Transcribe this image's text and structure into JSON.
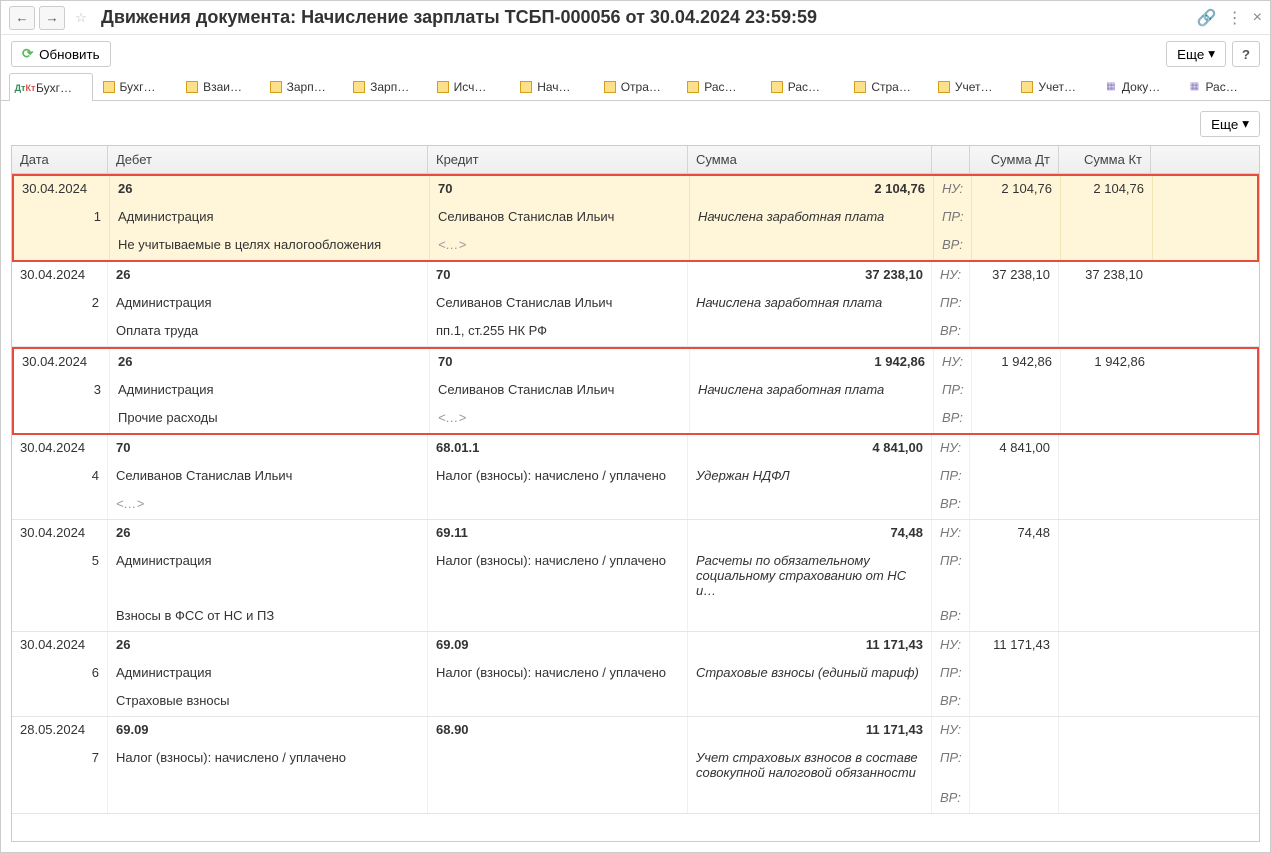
{
  "titlebar": {
    "title": "Движения документа: Начисление зарплаты ТСБП-000056 от 30.04.2024 23:59:59"
  },
  "toolbar": {
    "refresh_label": "Обновить",
    "more_label": "Еще",
    "help_label": "?"
  },
  "tabs": [
    {
      "label": "Бухг…",
      "active": true,
      "icon": "dtkt"
    },
    {
      "label": "Бухг…",
      "icon": "reg"
    },
    {
      "label": "Взаи…",
      "icon": "reg"
    },
    {
      "label": "Зарп…",
      "icon": "reg"
    },
    {
      "label": "Зарп…",
      "icon": "reg"
    },
    {
      "label": "Исч…",
      "icon": "reg"
    },
    {
      "label": "Нач…",
      "icon": "reg"
    },
    {
      "label": "Отра…",
      "icon": "reg"
    },
    {
      "label": "Рас…",
      "icon": "reg"
    },
    {
      "label": "Рас…",
      "icon": "reg"
    },
    {
      "label": "Стра…",
      "icon": "reg"
    },
    {
      "label": "Учет…",
      "icon": "reg"
    },
    {
      "label": "Учет…",
      "icon": "reg"
    },
    {
      "label": "Доку…",
      "icon": "tbl"
    },
    {
      "label": "Рас…",
      "icon": "tbl"
    }
  ],
  "inner_more_label": "Еще",
  "grid": {
    "headers": {
      "date": "Дата",
      "debit": "Дебет",
      "credit": "Кредит",
      "sum": "Сумма",
      "flag": "",
      "sumdt": "Сумма Дт",
      "sumkt": "Сумма Кт"
    },
    "flags": {
      "nu": "НУ:",
      "pr": "ПР:",
      "vr": "ВР:"
    },
    "entries": [
      {
        "highlight": true,
        "num": "1",
        "date": "30.04.2024",
        "debit_acct": "26",
        "credit_acct": "70",
        "sum": "2 104,76",
        "sumdt": "2 104,76",
        "sumkt": "2 104,76",
        "debit_l2": "Администрация",
        "credit_l2": "Селиванов Станислав Ильич",
        "desc_l2": "Начислена заработная плата",
        "debit_l3": "Не учитываемые в целях налогообложения",
        "credit_l3": "<…>"
      },
      {
        "num": "2",
        "date": "30.04.2024",
        "debit_acct": "26",
        "credit_acct": "70",
        "sum": "37 238,10",
        "sumdt": "37 238,10",
        "sumkt": "37 238,10",
        "debit_l2": "Администрация",
        "credit_l2": "Селиванов Станислав Ильич",
        "desc_l2": "Начислена заработная плата",
        "debit_l3": "Оплата труда",
        "credit_l3": "пп.1, ст.255 НК РФ"
      },
      {
        "redbox": true,
        "num": "3",
        "date": "30.04.2024",
        "debit_acct": "26",
        "credit_acct": "70",
        "sum": "1 942,86",
        "sumdt": "1 942,86",
        "sumkt": "1 942,86",
        "debit_l2": "Администрация",
        "credit_l2": "Селиванов Станислав Ильич",
        "desc_l2": "Начислена заработная плата",
        "debit_l3": "Прочие расходы",
        "credit_l3": "<…>"
      },
      {
        "num": "4",
        "date": "30.04.2024",
        "debit_acct": "70",
        "credit_acct": "68.01.1",
        "sum": "4 841,00",
        "sumdt": "4 841,00",
        "sumkt": "",
        "debit_l2": "Селиванов Станислав Ильич",
        "credit_l2": "Налог (взносы): начислено / уплачено",
        "desc_l2": "Удержан НДФЛ",
        "debit_l3": "<…>",
        "credit_l3": ""
      },
      {
        "num": "5",
        "date": "30.04.2024",
        "debit_acct": "26",
        "credit_acct": "69.11",
        "sum": "74,48",
        "sumdt": "74,48",
        "sumkt": "",
        "debit_l2": "Администрация",
        "credit_l2": "Налог (взносы): начислено / уплачено",
        "desc_l2": "Расчеты по обязательному социальному страхованию от НС и…",
        "debit_l3": "Взносы в ФСС от НС и ПЗ",
        "credit_l3": ""
      },
      {
        "num": "6",
        "date": "30.04.2024",
        "debit_acct": "26",
        "credit_acct": "69.09",
        "sum": "11 171,43",
        "sumdt": "11 171,43",
        "sumkt": "",
        "debit_l2": "Администрация",
        "credit_l2": "Налог (взносы): начислено / уплачено",
        "desc_l2": "Страховые взносы (единый тариф)",
        "debit_l3": "Страховые взносы",
        "credit_l3": ""
      },
      {
        "num": "7",
        "date": "28.05.2024",
        "debit_acct": "69.09",
        "credit_acct": "68.90",
        "sum": "11 171,43",
        "sumdt": "",
        "sumkt": "",
        "debit_l2": "Налог (взносы): начислено / уплачено",
        "credit_l2": "",
        "desc_l2": "Учет страховых взносов в составе совокупной налоговой обязанности",
        "debit_l3": "",
        "credit_l3": ""
      }
    ]
  }
}
